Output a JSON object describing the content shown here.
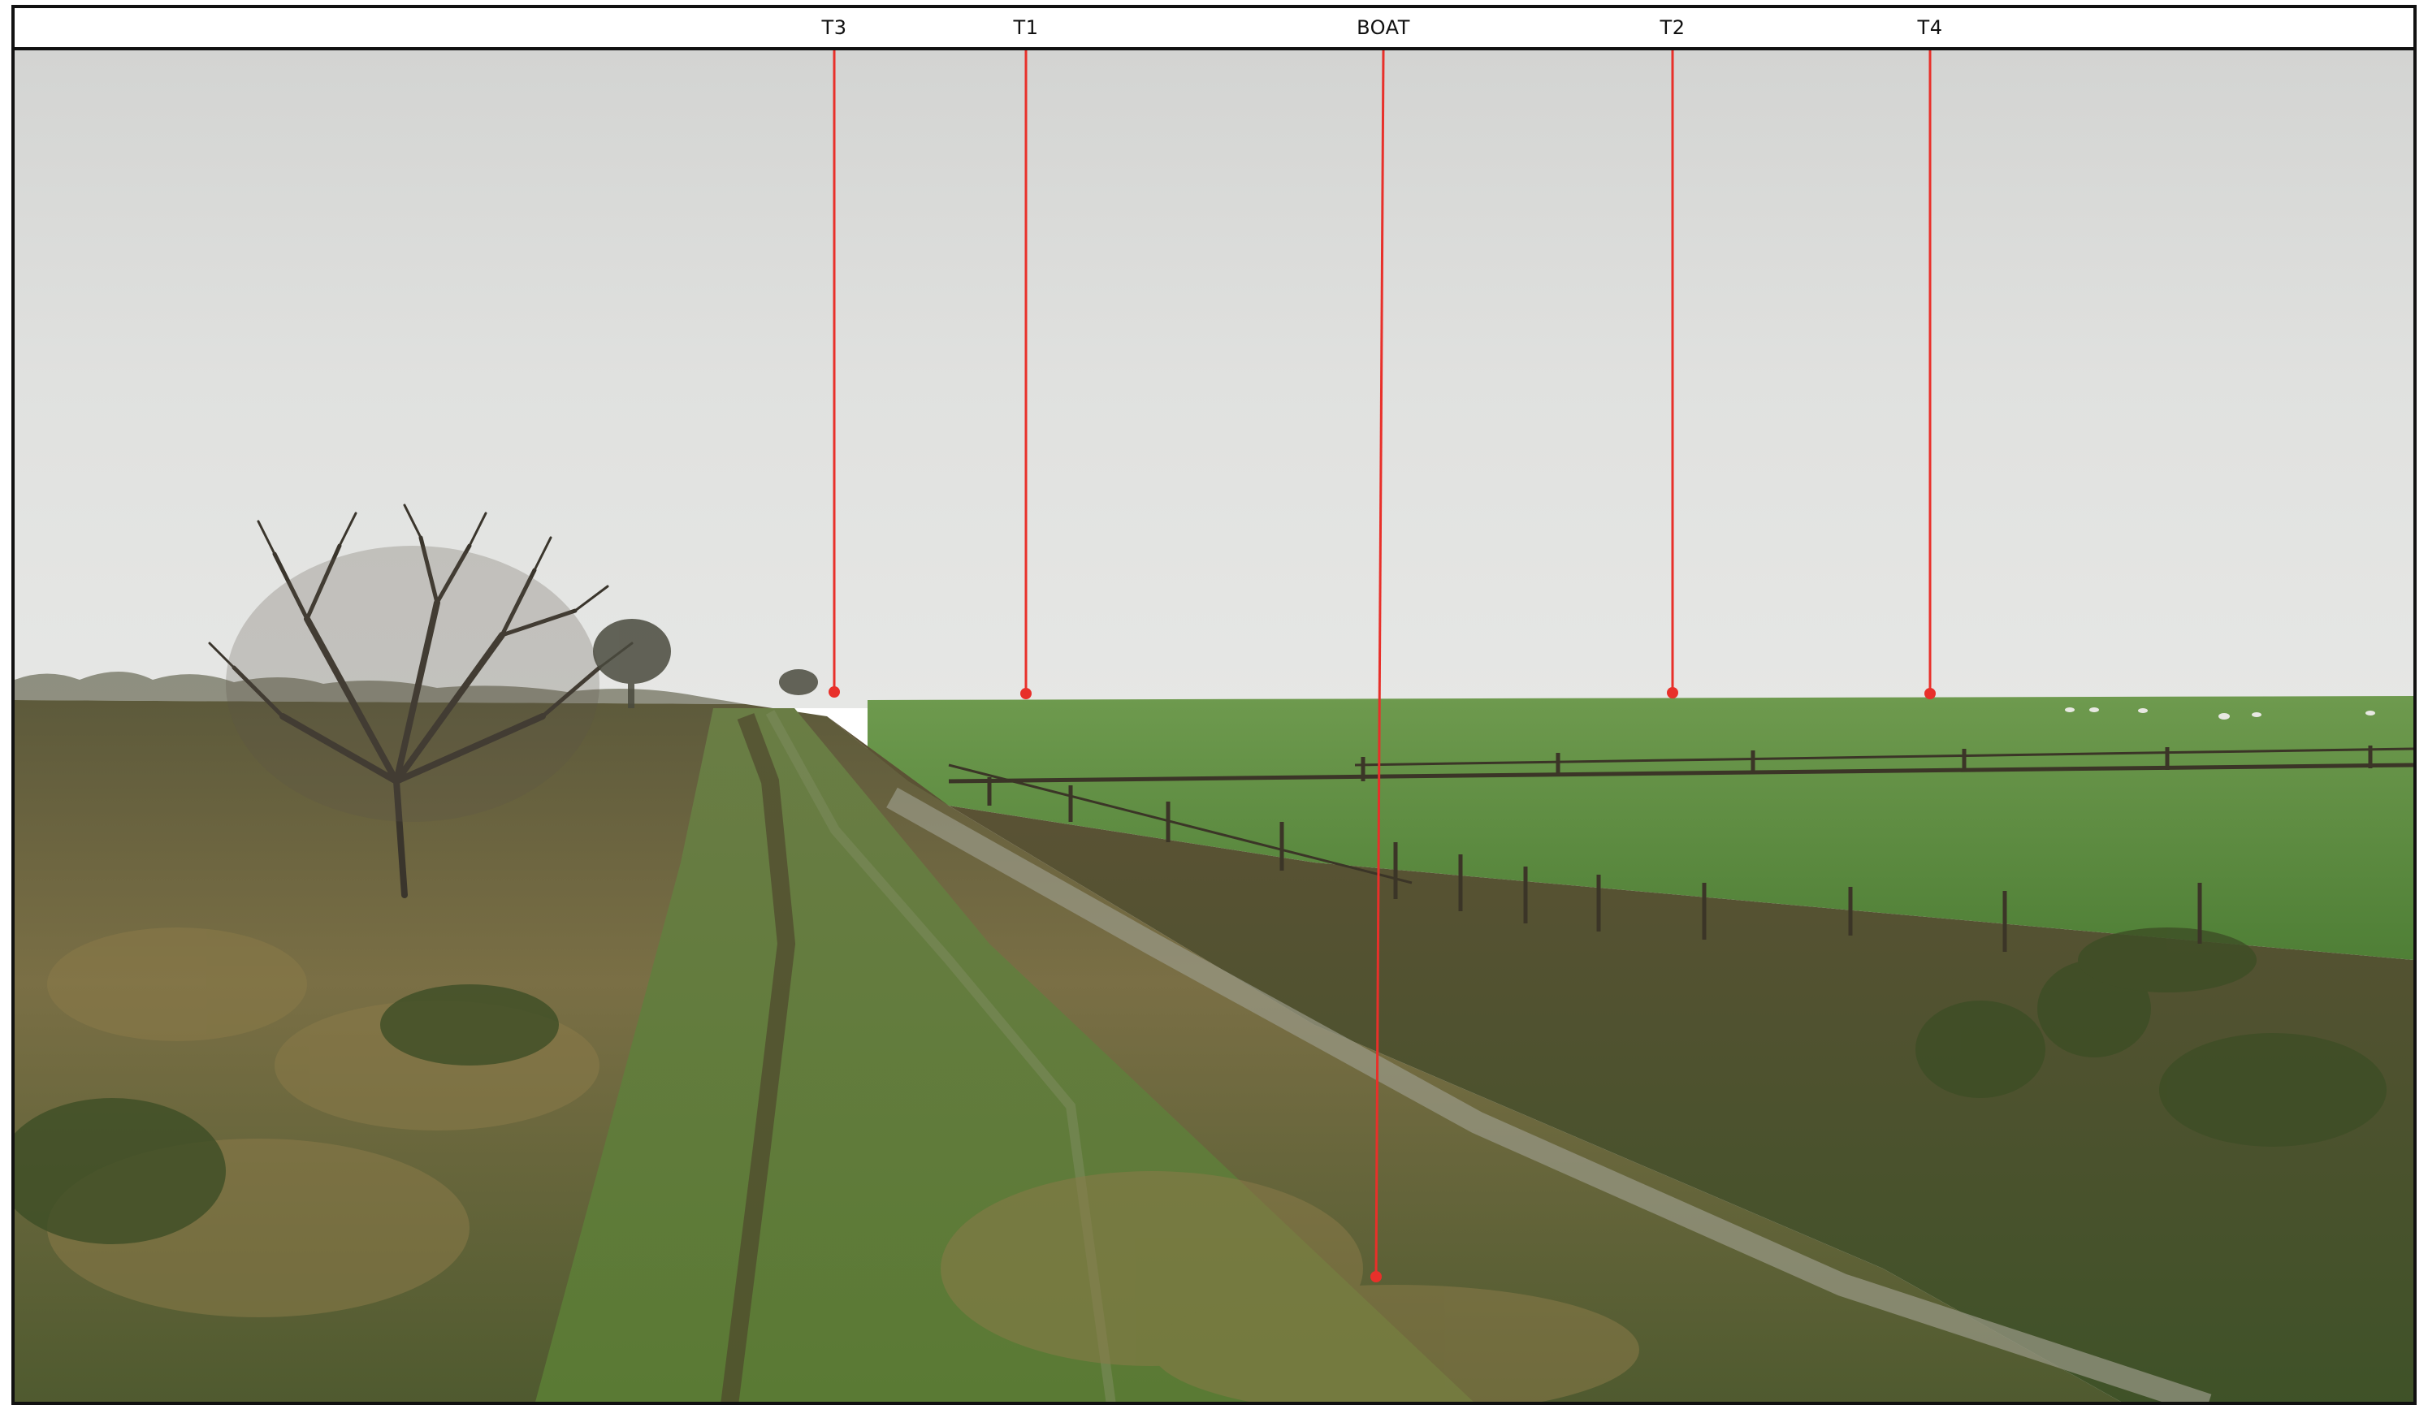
{
  "markers": [
    {
      "id": "t3",
      "label": "T3"
    },
    {
      "id": "t1",
      "label": "T1"
    },
    {
      "id": "boat",
      "label": "BOAT"
    },
    {
      "id": "t2",
      "label": "T2"
    },
    {
      "id": "t4",
      "label": "T4"
    }
  ],
  "colors": {
    "marker_line": "#e8302a",
    "frame": "#111111",
    "sky": "#dcdddb",
    "field": "#5c8a3f",
    "scrub": "#6d6440"
  }
}
